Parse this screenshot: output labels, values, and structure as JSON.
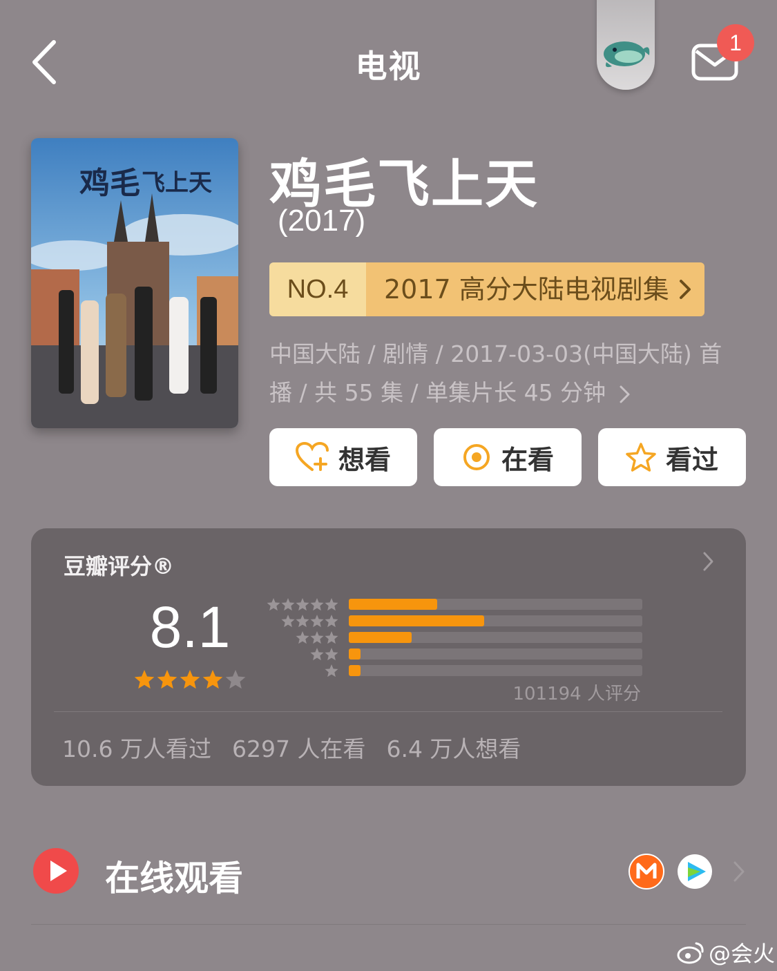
{
  "header": {
    "title": "电视",
    "mail_badge": "1",
    "icons": [
      "back-arrow-icon",
      "mascot-icon",
      "mail-icon"
    ]
  },
  "show": {
    "title": "鸡毛飞上天",
    "year": "(2017)"
  },
  "rank": {
    "number": "NO.4",
    "list": "2017 高分大陆电视剧集"
  },
  "meta": {
    "line1": "中国大陆 / 剧情 / 2017-03-03(中国大陆) 首",
    "line2": "播 / 共 55 集 / 单集片长 45 分钟"
  },
  "actions": {
    "want": "想看",
    "watching": "在看",
    "watched": "看过"
  },
  "rating": {
    "label": "豆瓣评分®",
    "score": "8.1",
    "stars": 4,
    "count": "101194 人评分",
    "distribution": [
      0.3,
      0.46,
      0.215,
      0.04,
      0.04
    ],
    "accent_color": "#f7950d"
  },
  "stats": {
    "watched": "10.6 万人看过",
    "watching": "6297 人在看",
    "want": "6.4 万人想看"
  },
  "online": {
    "label": "在线观看",
    "play_color": "#f04a4a"
  },
  "watermark": {
    "text": "@会火"
  }
}
